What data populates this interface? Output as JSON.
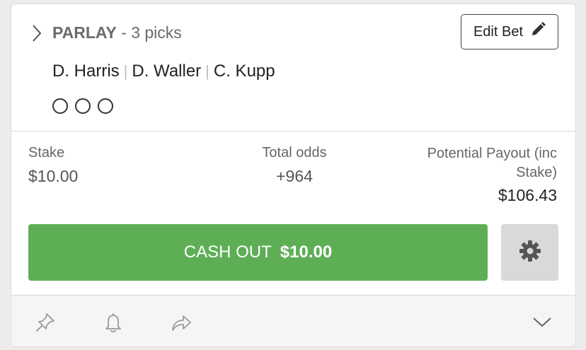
{
  "bet": {
    "type_label": "PARLAY",
    "separator": " - ",
    "picks_count_label": "3 picks",
    "edit_label": "Edit Bet",
    "picks": [
      "D. Harris",
      "D. Waller",
      "C. Kupp"
    ],
    "pick_separator": "|"
  },
  "summary": {
    "stake_label": "Stake",
    "stake_value": "$10.00",
    "odds_label": "Total odds",
    "odds_value": "+964",
    "payout_label_line1": "Potential Payout (inc",
    "payout_label_line2": "Stake)",
    "payout_value": "$106.43"
  },
  "cashout": {
    "label": "CASH OUT",
    "amount": "$10.00"
  },
  "colors": {
    "cashout_green": "#5eae56",
    "settings_gray": "#d9d9d9",
    "footer_bg": "#f5f5f5"
  },
  "icons": {
    "expand": "chevron-right-icon",
    "edit": "pencil-icon",
    "settings": "gear-icon",
    "pin": "pin-icon",
    "alert": "bell-icon",
    "share": "share-icon",
    "collapse": "chevron-down-icon"
  }
}
